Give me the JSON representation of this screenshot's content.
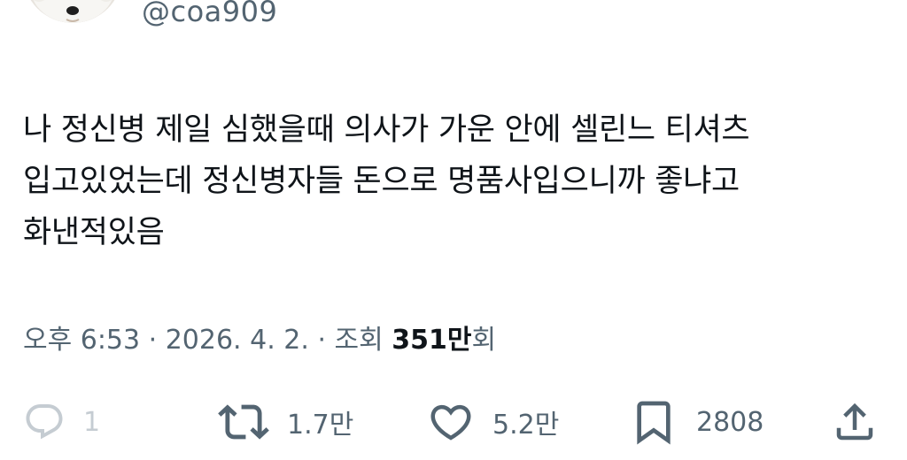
{
  "author": {
    "handle": "@coa909",
    "avatar_icon": "dog-avatar"
  },
  "tweet": {
    "lines": [
      "나 정신병 제일 심했을때 의사가 가운 안에 셀린느 티셔츠",
      "입고있었는데 정신병자들 돈으로 명품사입으니까 좋냐고",
      "화낸적있음"
    ]
  },
  "meta": {
    "prefix": "오후 6:53 · 2026. 4. 2. · 조회 ",
    "views": "351만",
    "suffix": "회"
  },
  "actions": {
    "reply": {
      "icon": "reply-icon",
      "count": "1"
    },
    "retweet": {
      "icon": "retweet-icon",
      "count": "1.7만"
    },
    "like": {
      "icon": "heart-icon",
      "count": "5.2만"
    },
    "bookmark": {
      "icon": "bookmark-icon",
      "count": "2808"
    },
    "share": {
      "icon": "share-icon"
    }
  },
  "colors": {
    "text_primary": "#0f1419",
    "text_secondary": "#536471",
    "disabled": "#c5ccd2"
  }
}
